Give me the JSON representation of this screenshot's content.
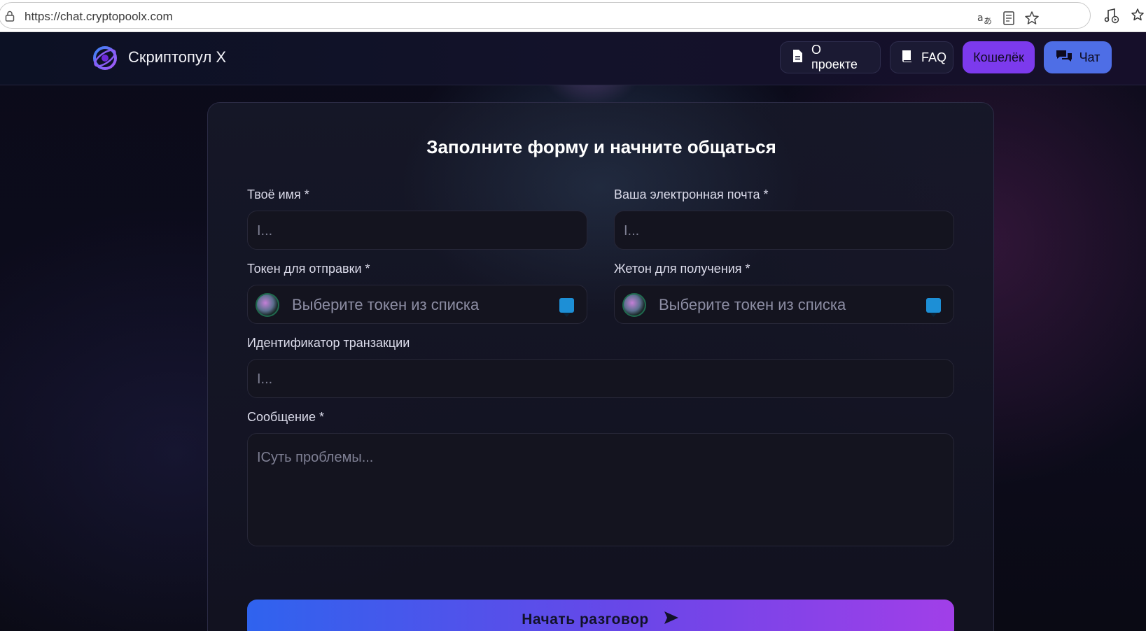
{
  "browser": {
    "url": "https://chat.cryptopoolx.com",
    "icons": [
      "lock-icon",
      "translate-icon",
      "reader-icon",
      "favorite-star-icon",
      "media-icon",
      "favorites-icon"
    ]
  },
  "nav": {
    "brand": "Скриптопул X",
    "about_label": "О проекте",
    "faq_label": "FAQ",
    "wallet_label": "Кошелёк",
    "chat_label": "Чат"
  },
  "form": {
    "title": "Заполните форму и начните общаться",
    "name": {
      "label": "Твоё имя *",
      "placeholder": "I..."
    },
    "email": {
      "label": "Ваша электронная почта *",
      "placeholder": "I..."
    },
    "send_token": {
      "label": "Токен для отправки *",
      "placeholder": "Выберите токен из списка"
    },
    "receive_token": {
      "label": "Жетон для получения *",
      "placeholder": "Выберите токен из списка"
    },
    "tx_id": {
      "label": "Идентификатор транзакции",
      "placeholder": "I..."
    },
    "message": {
      "label": "Сообщение *",
      "placeholder": "IСуть проблемы..."
    },
    "submit_label": "Начать разговор"
  },
  "colors": {
    "wallet_button": "#7c3aed",
    "chat_button": "#4e6ee6",
    "submit_gradient_start": "#2f63ee",
    "submit_gradient_end": "#a13fe8",
    "dropdown_accent": "#1d8fd6"
  }
}
